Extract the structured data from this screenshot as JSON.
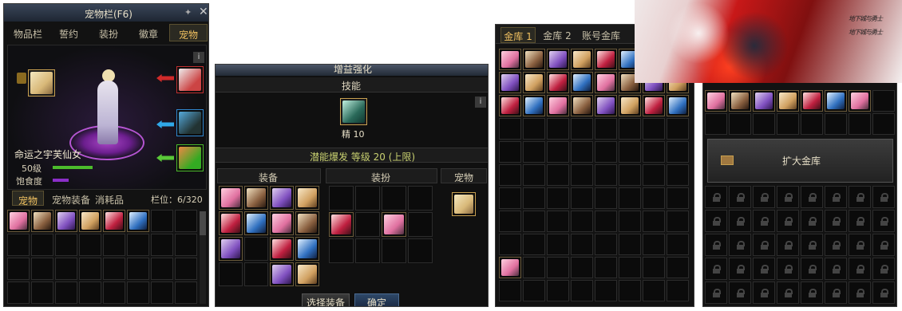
{
  "pet_panel": {
    "title": "宠物栏(F6)",
    "tabs": [
      "物品栏",
      "誓约",
      "装扮",
      "徽章",
      "宠物"
    ],
    "pet_name": "命运之宇芙仙女",
    "level": "50级",
    "satiety_label": "饱食度",
    "sub_tabs": [
      "宠物",
      "宠物装备",
      "消耗品"
    ],
    "slots_label": "栏位：6/320",
    "info": "i"
  },
  "enhance_panel": {
    "title": "增益强化",
    "skill_header": "技能",
    "skill_level": "精 10",
    "potential": "潜能爆发 等级 20 (上限)",
    "columns": [
      "装备",
      "装扮",
      "宠物"
    ],
    "select_button": "选择装备",
    "confirm_button": "确定",
    "info": "i"
  },
  "vault_panel": {
    "tabs": [
      "金库 1",
      "金库 2",
      "账号金库"
    ]
  },
  "vault2_panel": {
    "expand_button": "扩大金库"
  },
  "banner": {
    "logo_text": "地下城与勇士"
  },
  "colors": {
    "gold": "#c8a050",
    "bg": "#141414",
    "green": "#4cbb2c",
    "purple": "#8a2ec8",
    "potential": "#c8d070"
  }
}
